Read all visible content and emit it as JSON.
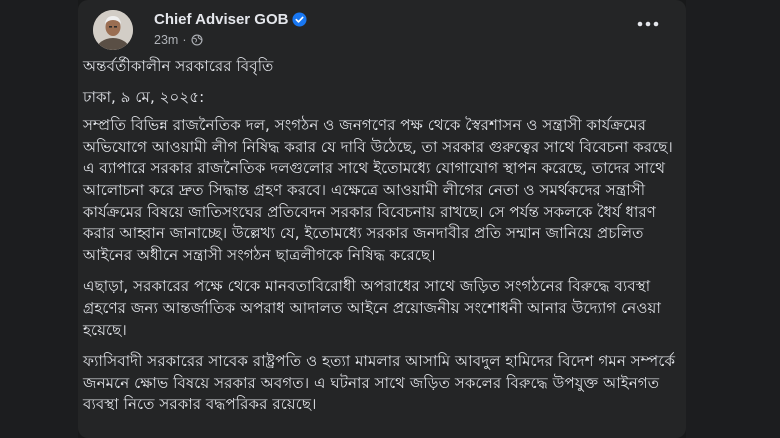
{
  "post": {
    "author": "Chief Adviser GOB",
    "time": "23m",
    "time_separator": "·",
    "title": "অন্তর্বর্তীকালীন সরকারের বিবৃতি",
    "dateline": "ঢাকা, ৯ মে, ২০২৫:",
    "paragraphs": [
      "সম্প্রতি বিভিন্ন রাজনৈতিক দল, সংগঠন ও জনগণের পক্ষ থেকে স্বৈরশাসন ও সন্ত্রাসী কার্যক্রমের অভিযোগে আওয়ামী লীগ নিষিদ্ধ করার যে দাবি উঠেছে, তা সরকার গুরুত্বের সাথে বিবেচনা করছে। এ ব্যাপারে সরকার রাজনৈতিক দলগুলোর সাথে ইতোমধ্যে যোগাযোগ স্থাপন করেছে, তাদের সাথে আলোচনা করে দ্রুত সিদ্ধান্ত গ্রহণ করবে। এক্ষেত্রে আওয়ামী লীগের নেতা ও সমর্থকদের সন্ত্রাসী কার্যক্রমের বিষয়ে জাতিসংঘের প্রতিবেদন সরকার বিবেচনায় রাখছে। সে পর্যন্ত সকলকে ধৈর্য ধারণ করার আহ্বান জানাচ্ছে। উল্লেখ্য যে, ইতোমধ্যে সরকার জনদাবীর প্রতি সম্মান জানিয়ে প্রচলিত আইনের অধীনে সন্ত্রাসী সংগঠন ছাত্রলীগকে নিষিদ্ধ করেছে।",
      "এছাড়া, সরকারের পক্ষে থেকে মানবতাবিরোধী অপরাধের সাথে জড়িত সংগঠনের বিরুদ্ধে ব্যবস্থা গ্রহণের জন্য আন্তর্জাতিক অপরাধ আদালত আইনে প্রয়োজনীয় সংশোধনী আনার উদ্যোগ নেওয়া হয়েছে।",
      "ফ্যাসিবাদী সরকারের সাবেক রাষ্ট্রপতি ও হত্যা মামলার আসামি আবদুল হামিদের বিদেশ গমন সম্পর্কে জনমনে ক্ষোভ বিষয়ে সরকার অবগত। এ ঘটনার সাথে জড়িত সকলের বিরুদ্ধে উপযুক্ত আইনগত ব্যবস্থা নিতে সরকার বদ্ধপরিকর রয়েছে।"
    ]
  },
  "icons": {
    "verified": "verified-badge-icon",
    "audience": "globe-icon",
    "more": "more-options-icon"
  },
  "colors": {
    "background": "#18191a",
    "card": "#242526",
    "text_primary": "#e4e6eb",
    "text_secondary": "#b0b3b8",
    "verified_blue": "#1877f2"
  }
}
